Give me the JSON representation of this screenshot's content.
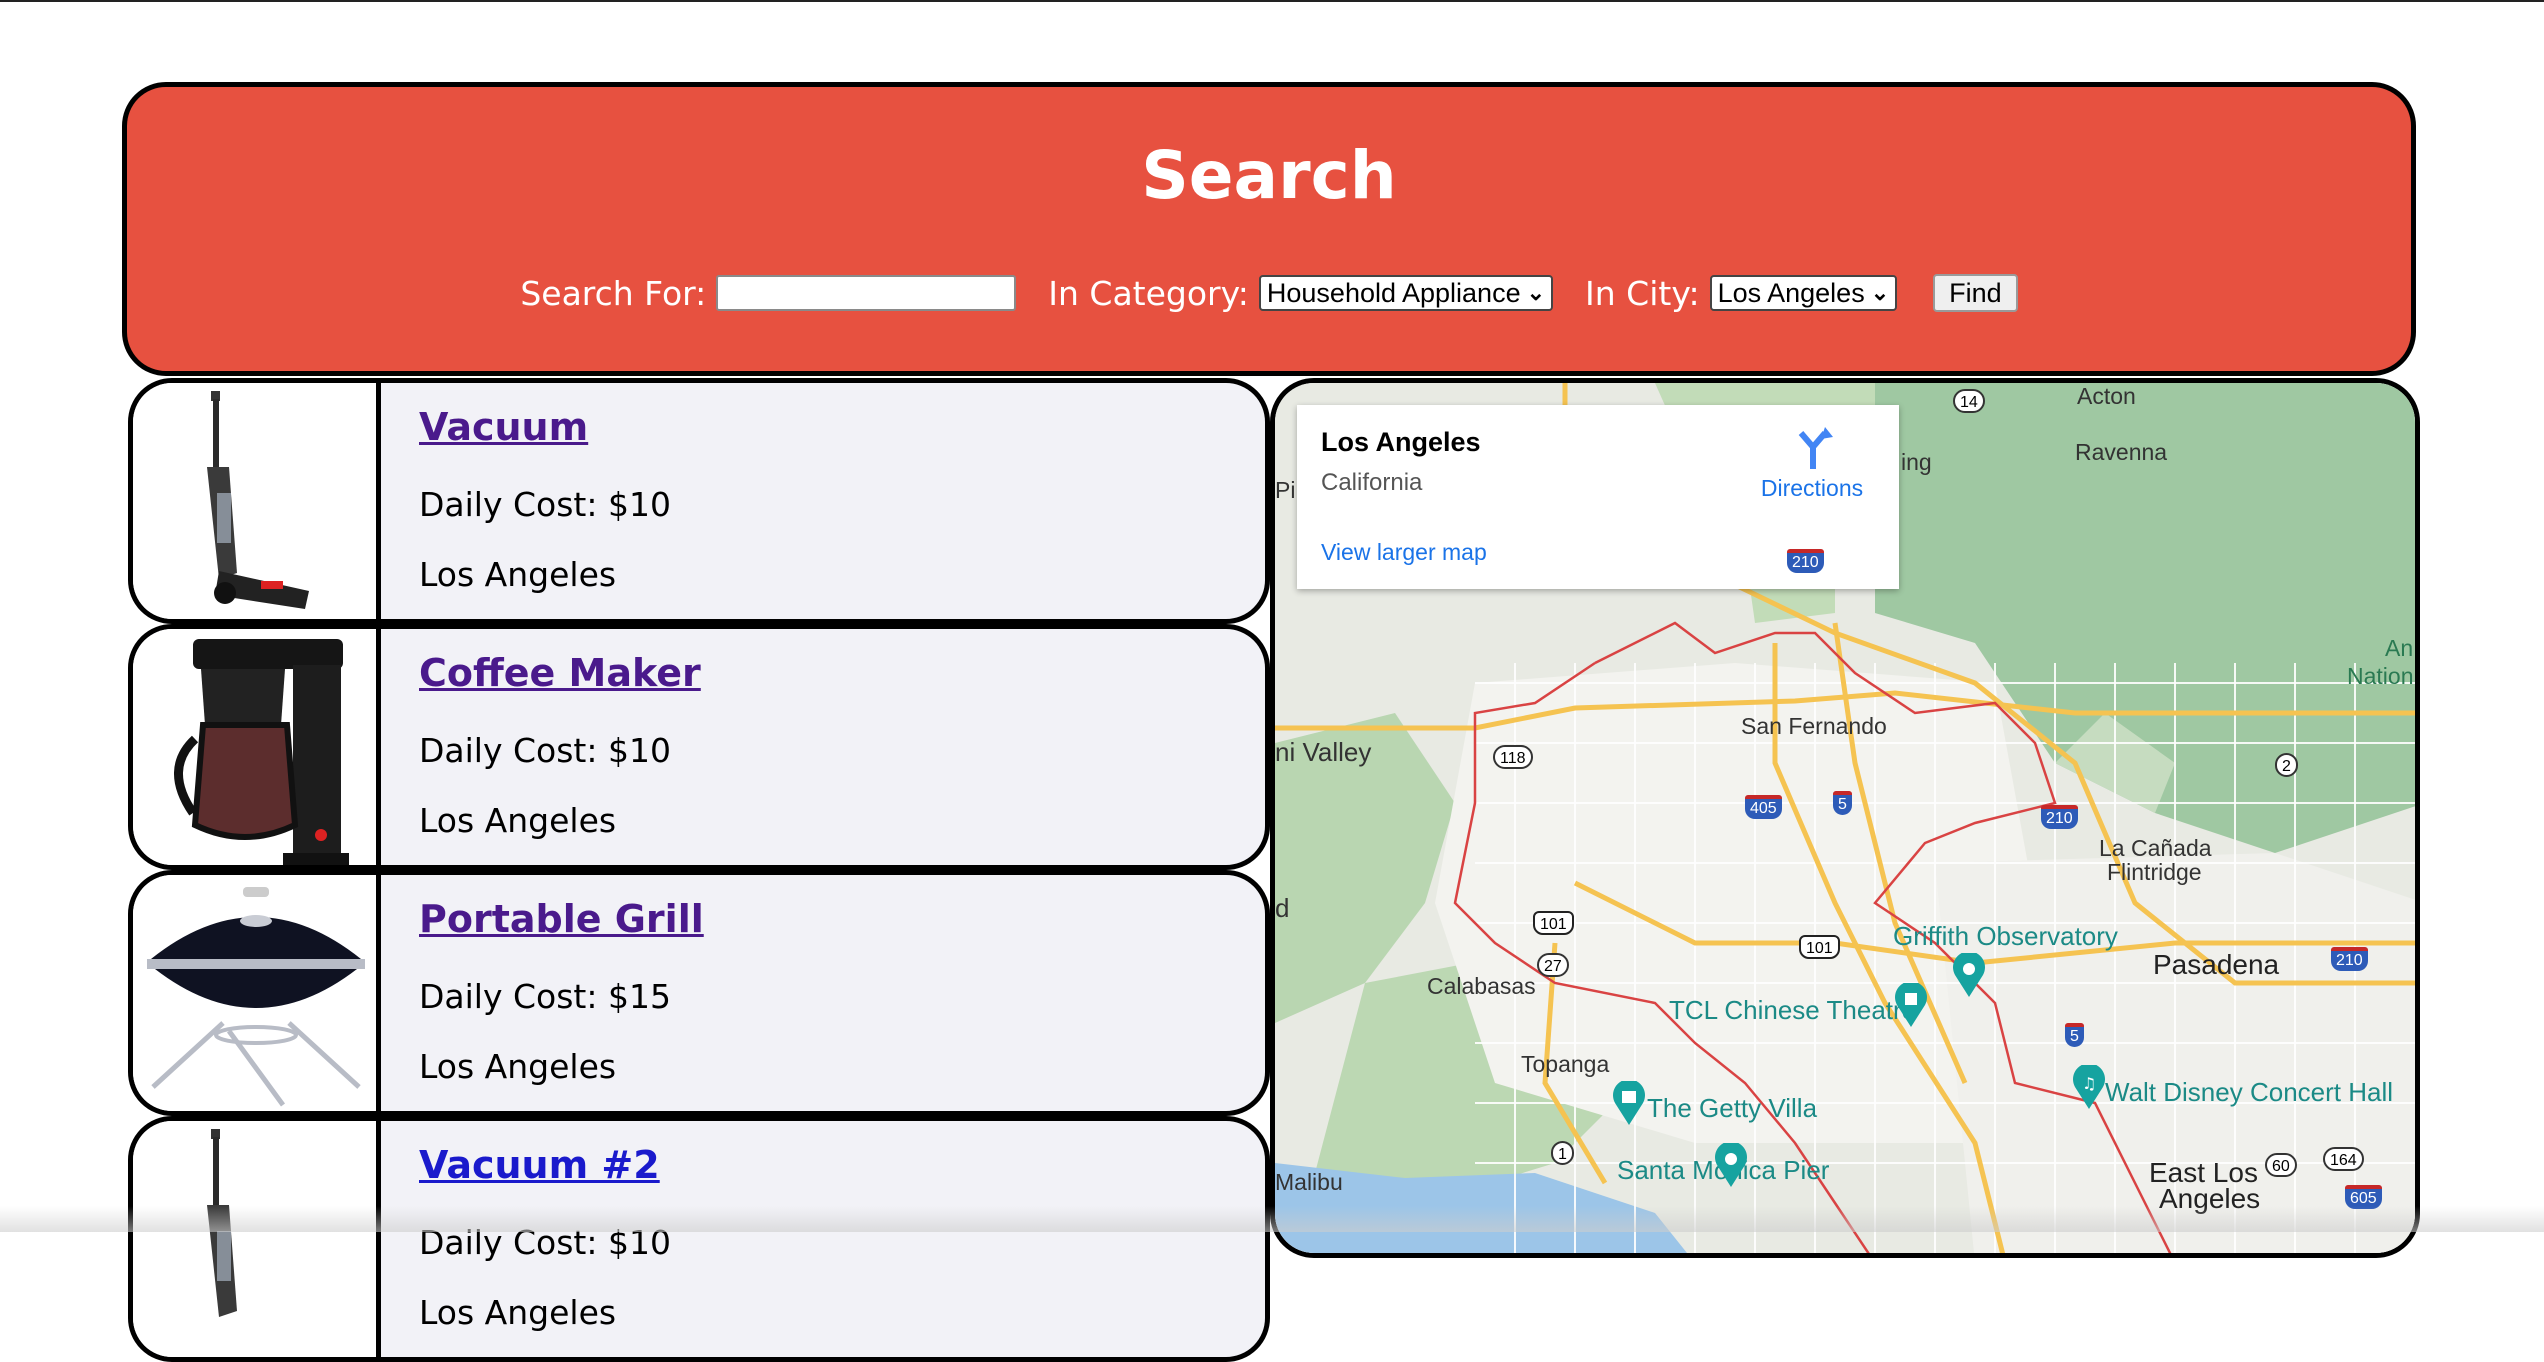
{
  "search": {
    "title": "Search",
    "search_for_label": "Search For:",
    "search_for_value": "",
    "category_label": "In Category:",
    "category_selected": "Household Appliance",
    "city_label": "In City:",
    "city_selected": "Los Angeles",
    "find_label": "Find"
  },
  "listings": [
    {
      "title": "Vacuum",
      "cost": "Daily Cost: $10",
      "city": "Los Angeles",
      "image": "vacuum-image"
    },
    {
      "title": "Coffee Maker",
      "cost": "Daily Cost: $10",
      "city": "Los Angeles",
      "image": "coffee-maker-image"
    },
    {
      "title": "Portable Grill",
      "cost": "Daily Cost: $15",
      "city": "Los Angeles",
      "image": "portable-grill-image"
    },
    {
      "title": "Vacuum #2",
      "cost": "Daily Cost: $10",
      "city": "Los Angeles",
      "image": "vacuum-image"
    }
  ],
  "map": {
    "card_title": "Los Angeles",
    "card_subtitle": "California",
    "directions_label": "Directions",
    "larger_map_label": "View larger map",
    "places": {
      "acton": "Acton",
      "ravenna": "Ravenna",
      "san_fernando": "San Fernando",
      "valley": "ni Valley",
      "la_canada": "La Cañada",
      "flintridge": "Flintridge",
      "calabasas": "Calabasas",
      "topanga": "Topanga",
      "malibu": "Malibu",
      "pasadena": "Pasadena",
      "east_la_1": "East Los",
      "east_la_2": "Angeles",
      "griffith": "Griffith Observatory",
      "tcl": "TCL Chinese Theatre",
      "getty": "The Getty Villa",
      "santa_monica": "Santa Monica Pier",
      "disney": "Walt Disney Concert Hall",
      "nation_1": "An",
      "nation_2": "Nation",
      "ping": "ing",
      "pi": "Pi",
      "d": "d"
    },
    "shields": {
      "r14": "14",
      "r210a": "210",
      "r118": "118",
      "r405": "405",
      "r5a": "5",
      "r210b": "210",
      "r2": "2",
      "r101a": "101",
      "r101b": "101",
      "r27": "27",
      "r5b": "5",
      "r210c": "210",
      "r1": "1",
      "r60": "60",
      "r164": "164",
      "r605": "605"
    }
  },
  "colors": {
    "header_bg": "#e75140",
    "listing_bg": "#f2f2f7",
    "visited_link": "#4a1a8c",
    "unvisited_link": "#1a1acc",
    "map_link": "#1a73e8",
    "poi": "#1b8a86"
  }
}
